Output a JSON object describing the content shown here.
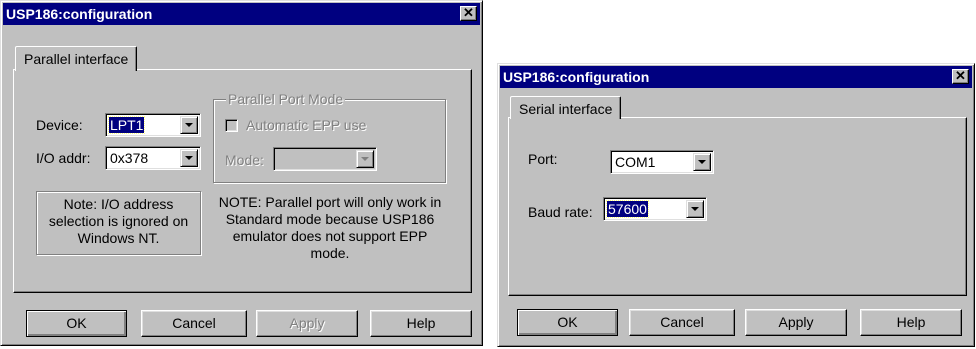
{
  "left": {
    "title": "USP186:configuration",
    "close": "✕",
    "tab_label": "Parallel interface",
    "device_label": "Device:",
    "device_value": "LPT1",
    "io_label": "I/O addr:",
    "io_value": "0x378",
    "note_text": "Note: I/O address selection is ignored on Windows NT.",
    "group_title": "Parallel Port Mode",
    "auto_epp_label": "Automatic EPP use",
    "mode_label": "Mode:",
    "mode_value": "",
    "note2_text": "NOTE: Parallel port will only work in Standard mode because USP186 emulator does not support EPP mode.",
    "buttons": {
      "ok": "OK",
      "cancel": "Cancel",
      "apply": "Apply",
      "help": "Help"
    }
  },
  "right": {
    "title": "USP186:configuration",
    "close": "✕",
    "tab_label": "Serial interface",
    "port_label": "Port:",
    "port_value": "COM1",
    "baud_label": "Baud rate:",
    "baud_value": "57600",
    "buttons": {
      "ok": "OK",
      "cancel": "Cancel",
      "apply": "Apply",
      "help": "Help"
    }
  }
}
